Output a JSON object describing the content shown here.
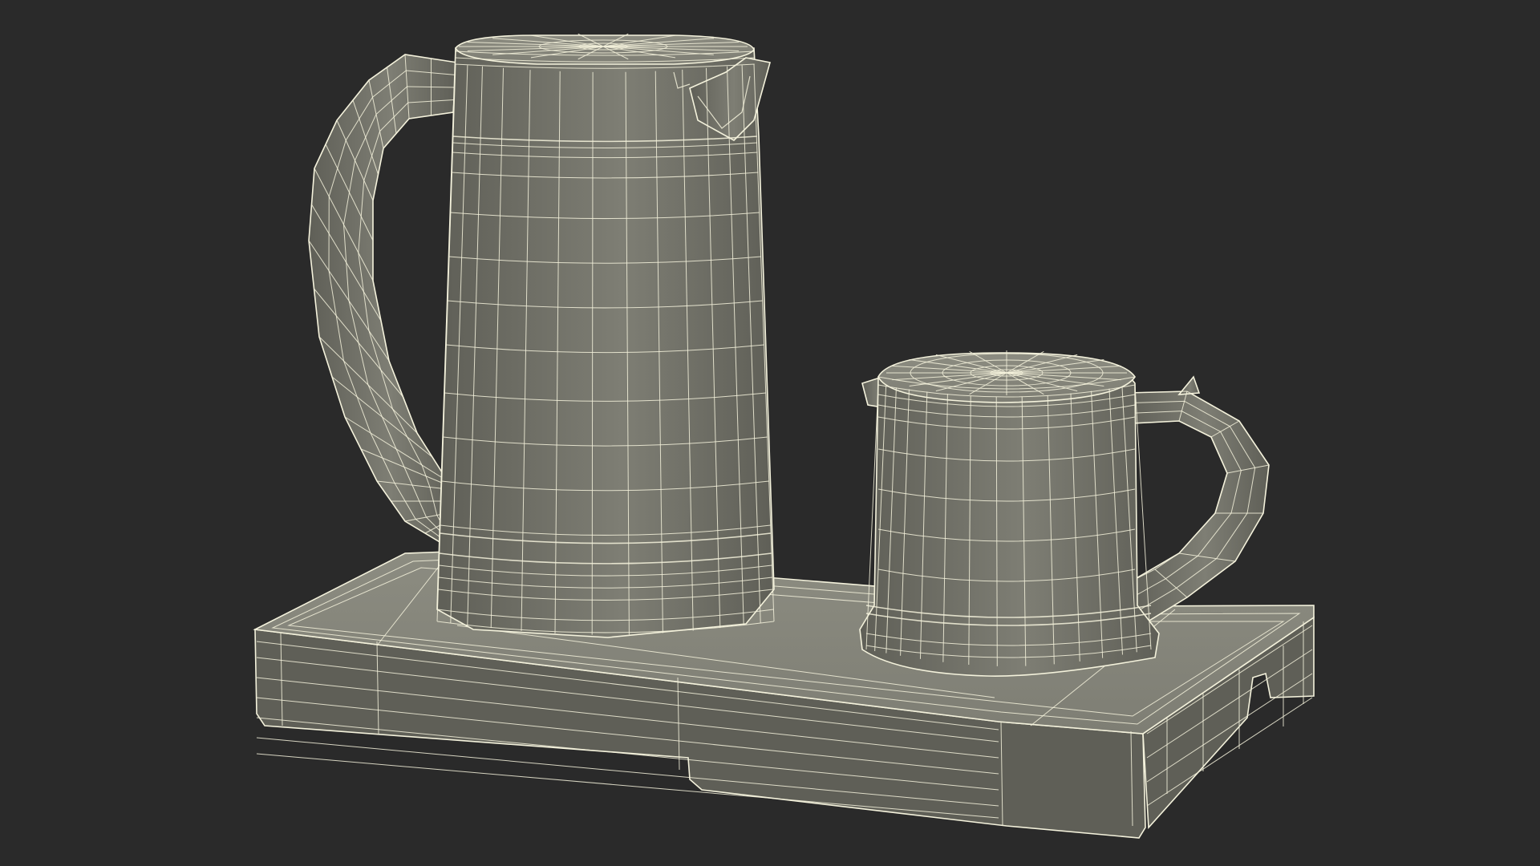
{
  "scene": {
    "background": "#2a2a2a",
    "surface_color": "#7e7e74",
    "surface_light": "#8c8c81",
    "surface_dark": "#5f5f57",
    "wire_color": "#f4f2dc",
    "objects": [
      "electric-kettle",
      "small-kettle",
      "tray-base"
    ]
  }
}
